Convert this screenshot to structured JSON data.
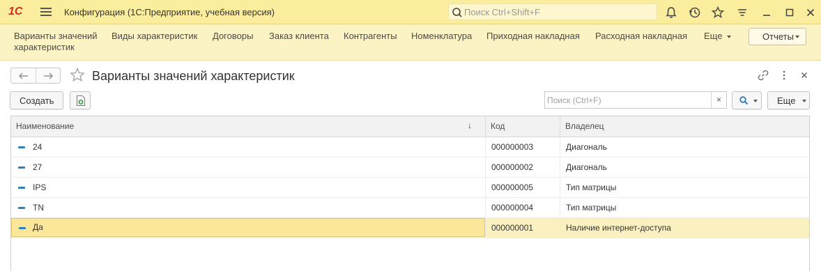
{
  "app": {
    "logo": "1С",
    "title": "Конфигурация  (1С:Предприятие, учебная версия)",
    "search_placeholder": "Поиск Ctrl+Shift+F"
  },
  "sections": {
    "items": [
      {
        "label": "Варианты значений характеристик"
      },
      {
        "label": "Виды характеристик"
      },
      {
        "label": "Договоры"
      },
      {
        "label": "Заказ клиента"
      },
      {
        "label": "Контрагенты"
      },
      {
        "label": "Номенклатура"
      },
      {
        "label": "Приходная накладная"
      },
      {
        "label": "Расходная накладная"
      }
    ],
    "more_label": "Еще",
    "reports_label": "Отчеты"
  },
  "form": {
    "title": "Варианты значений характеристик"
  },
  "commands": {
    "create_label": "Создать",
    "search_placeholder": "Поиск (Ctrl+F)",
    "clear_symbol": "×",
    "more_label": "Еще"
  },
  "table": {
    "columns": [
      "Наименование",
      "Код",
      "Владелец"
    ],
    "sort_indicator": "↓",
    "rows": [
      {
        "name": "24",
        "code": "000000003",
        "owner": "Диагональ"
      },
      {
        "name": "27",
        "code": "000000002",
        "owner": "Диагональ"
      },
      {
        "name": "IPS",
        "code": "000000005",
        "owner": "Тип матрицы"
      },
      {
        "name": "TN",
        "code": "000000004",
        "owner": "Тип матрицы"
      },
      {
        "name": "Да",
        "code": "000000001",
        "owner": "Наличие интернет-доступа",
        "selected": true
      }
    ]
  },
  "colors": {
    "titlebar": "#fbed9e",
    "sections_bar": "#fbf3c4",
    "selected_row": "#fbf0c0",
    "selected_cell": "#fbe79a",
    "logo_red": "#d42b1e",
    "item_icon": "#2f7fb8"
  }
}
